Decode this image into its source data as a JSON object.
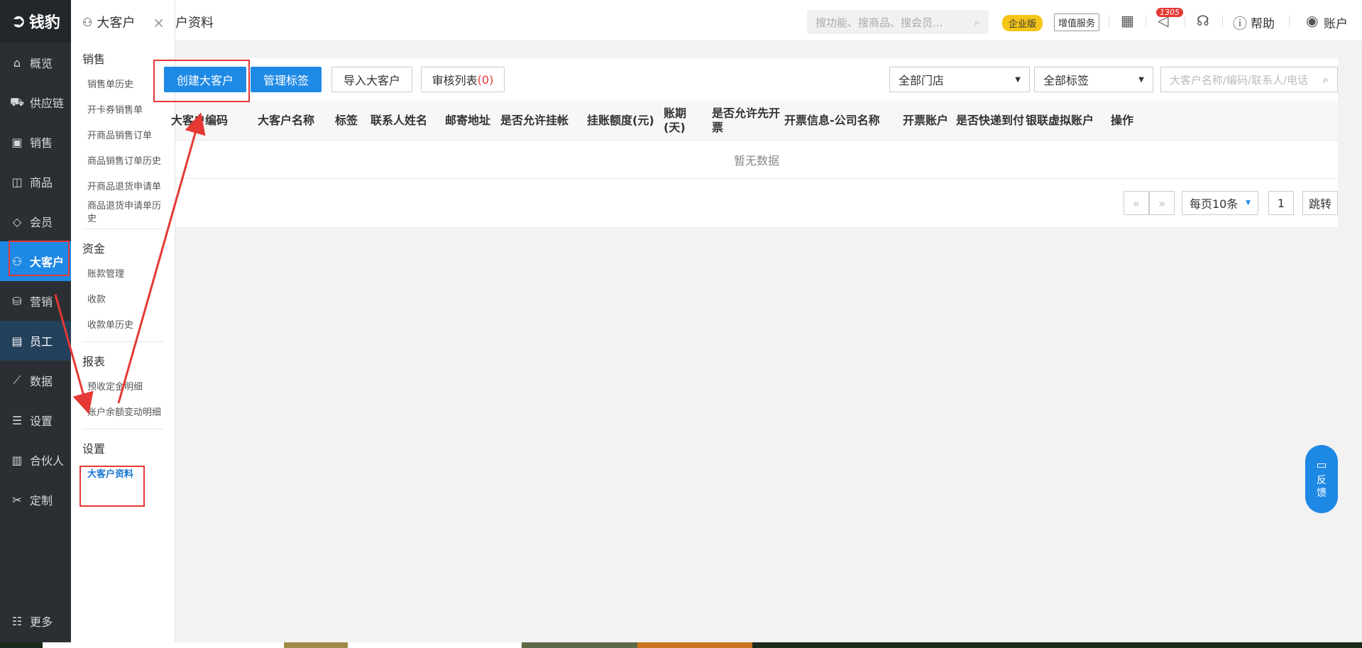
{
  "sidebar": {
    "logo": "钱豹",
    "items": [
      {
        "label": "概览",
        "icon": "house-icon",
        "glyph": "⌂"
      },
      {
        "label": "供应链",
        "icon": "truck-icon",
        "glyph": "⛟"
      },
      {
        "label": "销售",
        "icon": "cart-icon",
        "glyph": "▣"
      },
      {
        "label": "商品",
        "icon": "box-icon",
        "glyph": "◫"
      },
      {
        "label": "会员",
        "icon": "diamond-icon",
        "glyph": "◇"
      },
      {
        "label": "大客户",
        "icon": "handshake-icon",
        "glyph": "⚇"
      },
      {
        "label": "营销",
        "icon": "megaphone-icon",
        "glyph": "⛁"
      },
      {
        "label": "员工",
        "icon": "id-card-icon",
        "glyph": "▤"
      },
      {
        "label": "数据",
        "icon": "chart-icon",
        "glyph": "⟋"
      },
      {
        "label": "设置",
        "icon": "sliders-icon",
        "glyph": "☰"
      },
      {
        "label": "合伙人",
        "icon": "card-icon",
        "glyph": "▥"
      },
      {
        "label": "定制",
        "icon": "tools-icon",
        "glyph": "✂"
      }
    ],
    "more": "更多"
  },
  "subpanel": {
    "title": "大客户",
    "close": "×",
    "sections": [
      {
        "title": "销售",
        "links": [
          "销售单历史",
          "开卡券销售单",
          "开商品销售订单",
          "商品销售订单历史",
          "开商品退货申请单",
          "商品退货申请单历史"
        ]
      },
      {
        "title": "资金",
        "links": [
          "账款管理",
          "收款",
          "收款单历史"
        ]
      },
      {
        "title": "报表",
        "links": [
          "预收定金明细",
          "账户余额变动明细"
        ]
      },
      {
        "title": "设置",
        "links": [
          "大客户资料"
        ]
      }
    ]
  },
  "topbar": {
    "page_title": "户资料",
    "search_placeholder": "搜功能、搜商品、搜会员...",
    "edition": "企业版",
    "value_added": "增值服务",
    "notif_count": "1305",
    "help": "帮助",
    "account": "账户"
  },
  "toolbar": {
    "create": "创建大客户",
    "manage_tags": "管理标签",
    "import": "导入大客户",
    "review_list": "审核列表",
    "review_count": "(0)",
    "store_select": "全部门店",
    "tag_select": "全部标签",
    "search_placeholder": "大客户名称/编码/联系人/电话"
  },
  "table": {
    "headers": [
      "大客户编码",
      "大客户名称",
      "标签",
      "联系人姓名",
      "邮寄地址",
      "是否允许挂帐",
      "挂账额度(元)",
      "账期(天)",
      "是否允许先开票",
      "开票信息-公司名称",
      "开票账户",
      "是否快递到付",
      "银联虚拟账户",
      "操作"
    ],
    "empty_text": "暂无数据"
  },
  "pagination": {
    "prev": "«",
    "next": "»",
    "page_size": "每页10条",
    "page_input": "1",
    "jump": "跳转"
  },
  "feedback": {
    "label_1": "反",
    "label_2": "馈"
  }
}
